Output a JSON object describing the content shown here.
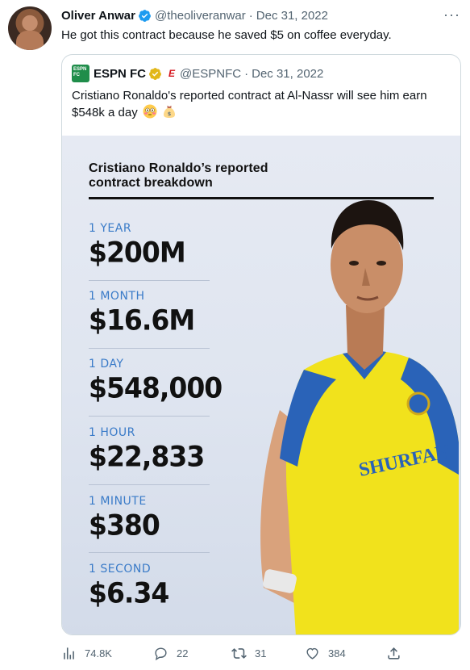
{
  "tweet": {
    "display_name": "Oliver Anwar",
    "handle": "@theoliveranwar",
    "date": "Dec 31, 2022",
    "text": "He got this contract because he saved $5 on coffee everyday.",
    "verified": true
  },
  "quoted": {
    "logo_text_1": "ESPN",
    "logo_text_2": "FC",
    "display_name": "ESPN FC",
    "handle": "@ESPNFC",
    "date": "Dec 31, 2022",
    "text": "Cristiano Ronaldo's reported contract at Al-Nassr will see him earn $548k a day",
    "emojis": [
      "flushed-face-icon",
      "money-bag-icon"
    ]
  },
  "graphic": {
    "title_line1": "Cristiano Ronaldo’s reported",
    "title_line2": "contract breakdown",
    "stats": [
      {
        "label": "1 YEAR",
        "value": "$200M"
      },
      {
        "label": "1 MONTH",
        "value": "$16.6M"
      },
      {
        "label": "1 DAY",
        "value": "$548,000"
      },
      {
        "label": "1 HOUR",
        "value": "$22,833"
      },
      {
        "label": "1 MINUTE",
        "value": "$380"
      },
      {
        "label": "1 SECOND",
        "value": "$6.34"
      }
    ],
    "jersey_sponsor": "SHURFAH"
  },
  "actions": {
    "views": "74.8K",
    "replies": "22",
    "retweets": "31",
    "likes": "384"
  },
  "colors": {
    "verified_blue": "#1d9bf0",
    "espn_gold_badge": "#e2b719",
    "stat_label_blue": "#3a7bc8",
    "jersey_yellow": "#f1e21c",
    "jersey_blue": "#2a63b8"
  }
}
